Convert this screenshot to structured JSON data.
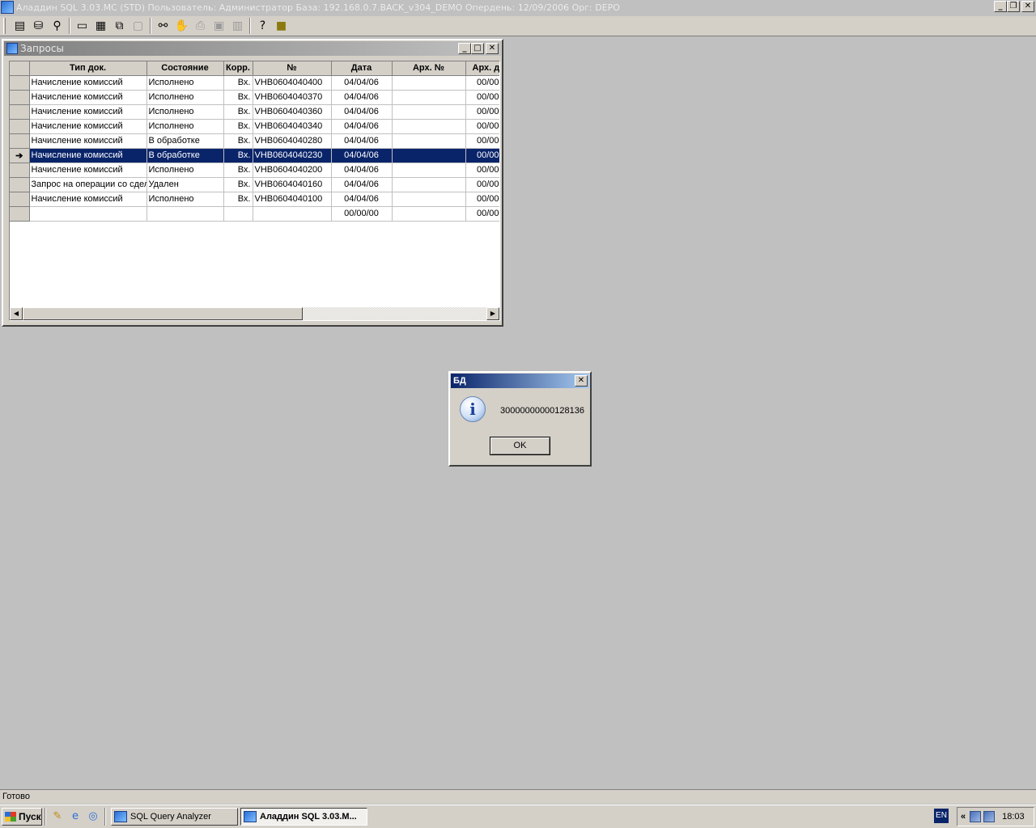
{
  "app": {
    "title": "Аладдин SQL 3.03.MC (STD)  Пользователь: Администратор База: 192.168.0.7.BACK_v304_DEMO Опердень: 12/09/2006 Орг: DEPO",
    "caption_buttons": [
      "_",
      "❐",
      "✕"
    ]
  },
  "toolbar": {
    "icons": [
      "document-icon",
      "database-icon",
      "filter-icon",
      "window-icon",
      "tile-icon",
      "cascade-icon",
      "arrange-icon",
      "find-icon",
      "stop-icon",
      "print-icon",
      "save-icon",
      "calendar-icon",
      "help-icon",
      "exit-icon"
    ]
  },
  "window": {
    "title": "Запросы",
    "caption_buttons": [
      "_",
      "□",
      "✕"
    ],
    "columns": [
      "Тип док.",
      "Состояние",
      "Корр.",
      "№",
      "Дата",
      "Арх. №",
      "Арх. д"
    ],
    "rows": [
      {
        "type": "Начисление комиссий",
        "state": "Исполнено",
        "corr": "Вх.",
        "num": "VHB0604040400",
        "date": "04/04/06",
        "arch_num": "",
        "arch_date": "00/00",
        "indicator": ""
      },
      {
        "type": "Начисление комиссий",
        "state": "Исполнено",
        "corr": "Вх.",
        "num": "VHB0604040370",
        "date": "04/04/06",
        "arch_num": "",
        "arch_date": "00/00",
        "indicator": ""
      },
      {
        "type": "Начисление комиссий",
        "state": "Исполнено",
        "corr": "Вх.",
        "num": "VHB0604040360",
        "date": "04/04/06",
        "arch_num": "",
        "arch_date": "00/00",
        "indicator": ""
      },
      {
        "type": "Начисление комиссий",
        "state": "Исполнено",
        "corr": "Вх.",
        "num": "VHB0604040340",
        "date": "04/04/06",
        "arch_num": "",
        "arch_date": "00/00",
        "indicator": ""
      },
      {
        "type": "Начисление комиссий",
        "state": "В обработке",
        "corr": "Вх.",
        "num": "VHB0604040280",
        "date": "04/04/06",
        "arch_num": "",
        "arch_date": "00/00",
        "indicator": ""
      },
      {
        "type": "Начисление комиссий",
        "state": "В обработке",
        "corr": "Вх.",
        "num": "VHB0604040230",
        "date": "04/04/06",
        "arch_num": "",
        "arch_date": "00/00",
        "indicator": "➔"
      },
      {
        "type": "Начисление комиссий",
        "state": "Исполнено",
        "corr": "Вх.",
        "num": "VHB0604040200",
        "date": "04/04/06",
        "arch_num": "",
        "arch_date": "00/00",
        "indicator": ""
      },
      {
        "type": "Запрос на операции со сдел",
        "state": "Удален",
        "corr": "Вх.",
        "num": "VHB0604040160",
        "date": "04/04/06",
        "arch_num": "",
        "arch_date": "00/00",
        "indicator": ""
      },
      {
        "type": "Начисление комиссий",
        "state": "Исполнено",
        "corr": "Вх.",
        "num": "VHB0604040100",
        "date": "04/04/06",
        "arch_num": "",
        "arch_date": "00/00",
        "indicator": ""
      },
      {
        "type": "",
        "state": "",
        "corr": "",
        "num": "",
        "date": "00/00/00",
        "arch_num": "",
        "arch_date": "00/00",
        "indicator": ""
      }
    ],
    "selected_row": 5
  },
  "dialog": {
    "title": "БД",
    "message": "30000000000128136",
    "ok_label": "OK",
    "icon_glyph": "i",
    "close_glyph": "✕"
  },
  "statusbar": {
    "text": "Готово"
  },
  "taskbar": {
    "start_label": "Пуск",
    "tasks": [
      {
        "label": "SQL Query Analyzer",
        "active": false
      },
      {
        "label": "Аладдин SQL 3.03.M...",
        "active": true
      }
    ],
    "lang": "EN",
    "tray_chevron": "«",
    "clock": "18:03"
  },
  "colors": {
    "selection": "#0a246a",
    "face": "#d4d0c8",
    "desktop": "#c0c0c0"
  }
}
